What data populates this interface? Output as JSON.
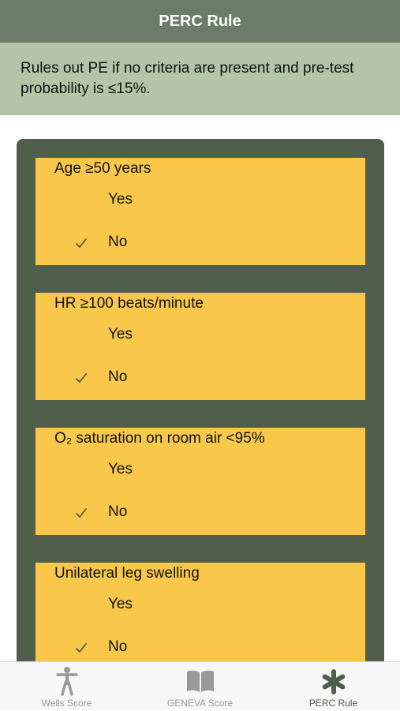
{
  "header": {
    "title": "PERC Rule"
  },
  "info": {
    "text": "Rules out PE if no criteria are present and pre-test probability is ≤15%."
  },
  "criteria": [
    {
      "title": "Age ≥50 years",
      "yes_label": "Yes",
      "no_label": "No",
      "selected": "No"
    },
    {
      "title": "HR ≥100 beats/minute",
      "yes_label": "Yes",
      "no_label": "No",
      "selected": "No"
    },
    {
      "title": "O₂ saturation on room air <95%",
      "yes_label": "Yes",
      "no_label": "No",
      "selected": "No"
    },
    {
      "title": "Unilateral leg swelling",
      "yes_label": "Yes",
      "no_label": "No",
      "selected": "No"
    }
  ],
  "tabs": [
    {
      "label": "Wells Score",
      "icon": "person-icon",
      "selected": false
    },
    {
      "label": "GENEVA Score",
      "icon": "book-icon",
      "selected": false
    },
    {
      "label": "PERC Rule",
      "icon": "asterisk-icon",
      "selected": true
    }
  ],
  "colors": {
    "nav": "#6b7c68",
    "banner": "#b3c4a8",
    "panel": "#4f5f4b",
    "card": "#f9c84a",
    "tab_active": "#4f5f4b",
    "tab_inactive": "#999999"
  }
}
